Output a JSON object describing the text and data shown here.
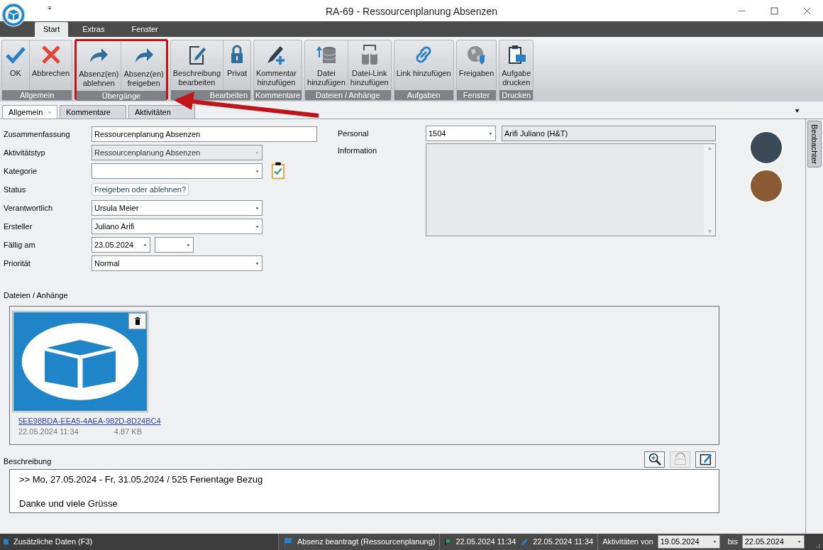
{
  "window": {
    "title": "RA-69 - Ressourcenplanung Absenzen"
  },
  "ribbon": {
    "tabs": [
      {
        "label": "Start",
        "selected": true
      },
      {
        "label": "Extras",
        "selected": false
      },
      {
        "label": "Fenster",
        "selected": false
      }
    ],
    "groups": [
      {
        "label": "Allgemein",
        "highlighted": false,
        "buttons": [
          {
            "label": "OK"
          },
          {
            "label": "Abbrechen"
          }
        ]
      },
      {
        "label": "Übergänge",
        "highlighted": true,
        "buttons": [
          {
            "label": "Absenz(en)\nablehnen"
          },
          {
            "label": "Absenz(en)\nfreigeben"
          }
        ]
      },
      {
        "label": "Bearbeiten",
        "highlighted": false,
        "buttons": [
          {
            "label": "Beschreibung\nbearbeiten"
          },
          {
            "label": "Privat"
          }
        ]
      },
      {
        "label": "Kommentare",
        "highlighted": false,
        "buttons": [
          {
            "label": "Kommentar\nhinzufügen"
          }
        ]
      },
      {
        "label": "Dateien / Anhänge",
        "highlighted": false,
        "buttons": [
          {
            "label": "Datei\nhinzufügen"
          },
          {
            "label": "Datei-Link\nhinzufügen"
          }
        ]
      },
      {
        "label": "Aufgaben",
        "highlighted": false,
        "buttons": [
          {
            "label": "Link hinzufügen"
          }
        ]
      },
      {
        "label": "Fenster",
        "highlighted": false,
        "buttons": [
          {
            "label": "Freigaben"
          }
        ]
      },
      {
        "label": "Drucken",
        "highlighted": false,
        "buttons": [
          {
            "label": "Aufgabe\ndrucken"
          }
        ]
      }
    ]
  },
  "doc_tabs": [
    {
      "label": "Allgemein",
      "selected": true
    },
    {
      "label": "Kommentare",
      "selected": false
    },
    {
      "label": "Aktivitäten",
      "selected": false
    }
  ],
  "form": {
    "fields": [
      {
        "label": "Zusammenfassung",
        "kind": "text",
        "value": "Ressourcenplanung Absenzen"
      },
      {
        "label": "Aktivitätstyp",
        "kind": "combo",
        "value": "Ressourcenplanung Absenzen",
        "disabled": true
      },
      {
        "label": "Kategorie",
        "kind": "combo",
        "disabled": false
      },
      {
        "label": "Status",
        "kind": "button",
        "value": "Freigeben oder ablehnen?"
      },
      {
        "label": "Verantwortlich",
        "kind": "combo",
        "value": "Ursula Meier",
        "disabled": false
      },
      {
        "label": "Ersteller",
        "kind": "combo",
        "value": "Juliano Arifi",
        "disabled": false
      },
      {
        "label": "Fällig am",
        "kind": "date",
        "value": "23.05.2024"
      },
      {
        "label": "Priorität",
        "kind": "combo",
        "value": "Normal",
        "disabled": false
      }
    ],
    "personal": {
      "label": "Personal",
      "number": "1504",
      "name": "Arifi Juliano (H&T)"
    },
    "information": {
      "label": "Information"
    }
  },
  "attachments": {
    "label": "Dateien / Anhänge",
    "files": [
      {
        "name": "5EE98BDA-EEA5-4AEA-982D-8D24BC4",
        "date": "22.05.2024 11:34",
        "size": "4.87 KB"
      }
    ]
  },
  "description": {
    "label": "Beschreibung",
    "paragraphs": [
      ">> Mo, 27.05.2024 - Fr, 31.05.2024 / 525 Ferientage Bezug",
      "Danke und viele Grüsse"
    ]
  },
  "side_tab": {
    "label": "Beobachter"
  },
  "status_bar": {
    "extra": "Zusätzliche Daten (F3)",
    "state": "Absenz beantragt (Ressourcenplanung)",
    "created": "22.05.2024 11:34",
    "modified": "22.05.2024 11:34",
    "activities_label": "Aktivitäten von",
    "from": "19.05.2024",
    "to_label": "bis",
    "to": "22.05.2024"
  }
}
